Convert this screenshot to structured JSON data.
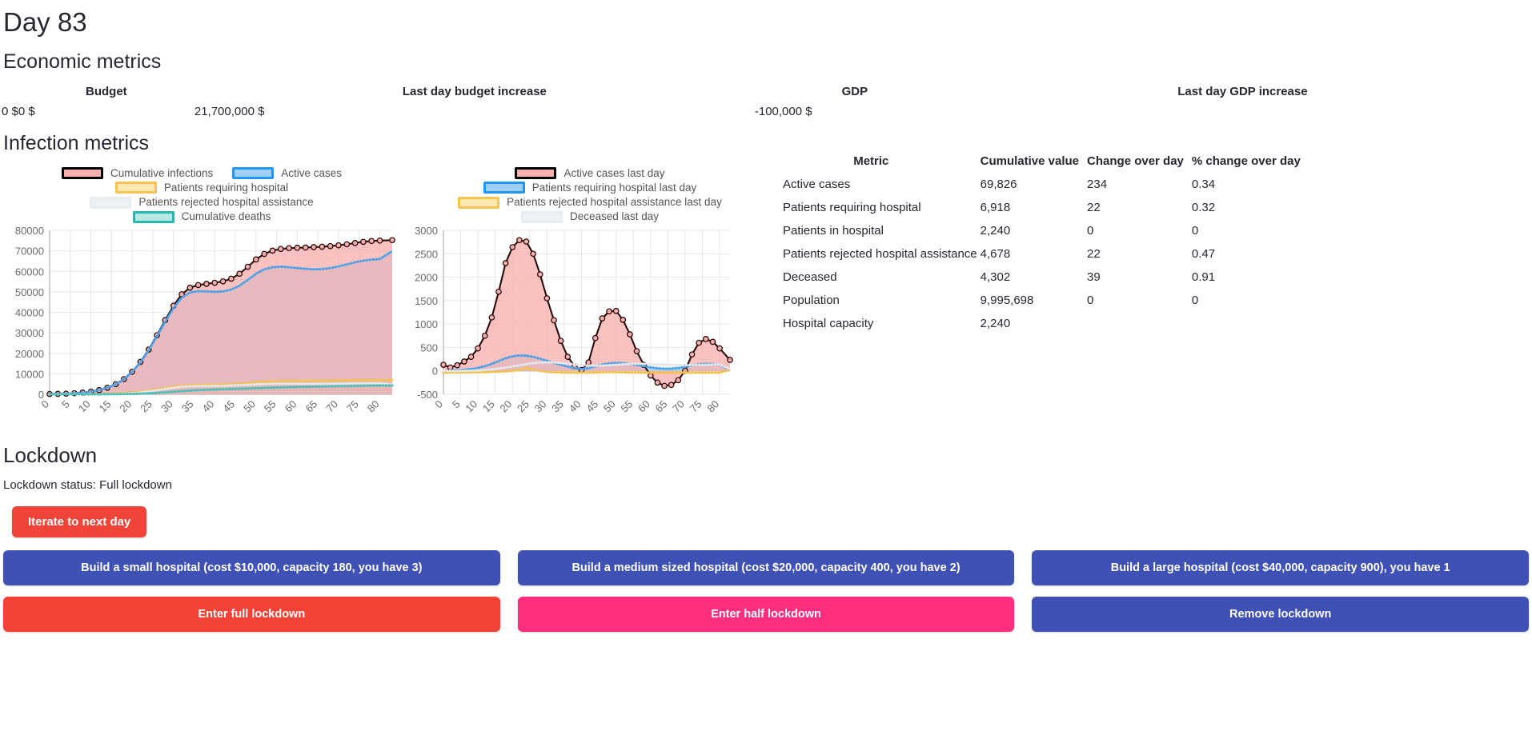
{
  "header": {
    "day_title": "Day 83"
  },
  "economic": {
    "section_title": "Economic metrics",
    "headers": [
      "Budget",
      "Last day budget increase",
      "GDP",
      "Last day GDP increase"
    ],
    "values": [
      "0 $",
      "0 $",
      "21,700,000 $",
      "-100,000 $"
    ]
  },
  "infection": {
    "section_title": "Infection metrics",
    "left_legend": [
      "Cumulative infections",
      "Active cases",
      "Patients requiring hospital",
      "Patients rejected hospital assistance",
      "Cumulative deaths"
    ],
    "right_legend": [
      "Active cases last day",
      "Patients requiring hospital last day",
      "Patients rejected hospital assistance last day",
      "Deceased last day"
    ],
    "table_headers": [
      "Metric",
      "Cumulative value",
      "Change over day",
      "% change over day"
    ],
    "rows": [
      {
        "metric": "Active cases",
        "cumulative": "69,826",
        "change": "234",
        "pct": "0.34"
      },
      {
        "metric": "Patients requiring hospital",
        "cumulative": "6,918",
        "change": "22",
        "pct": "0.32"
      },
      {
        "metric": "Patients in hospital",
        "cumulative": "2,240",
        "change": "0",
        "pct": "0"
      },
      {
        "metric": "Patients rejected hospital assistance",
        "cumulative": "4,678",
        "change": "22",
        "pct": "0.47"
      },
      {
        "metric": "Deceased",
        "cumulative": "4,302",
        "change": "39",
        "pct": "0.91"
      },
      {
        "metric": "Population",
        "cumulative": "9,995,698",
        "change": "0",
        "pct": "0"
      },
      {
        "metric": "Hospital capacity",
        "cumulative": "2,240",
        "change": "",
        "pct": ""
      }
    ]
  },
  "lockdown": {
    "section_title": "Lockdown",
    "status_text": "Lockdown status: Full lockdown",
    "iterate_label": "Iterate to next day",
    "build_buttons": [
      "Build a small hospital (cost $10,000, capacity 180, you have 3)",
      "Build a medium sized hospital (cost $20,000, capacity 400, you have 2)",
      "Build a large hospital (cost $40,000, capacity 900), you have 1"
    ],
    "lockdown_buttons": [
      "Enter full lockdown",
      "Enter half lockdown",
      "Remove lockdown"
    ]
  },
  "colors": {
    "cumulative_infections": "#f7b0ae",
    "active_cases": "#7fc4f2",
    "patients_requiring_hospital": "#fbd87f",
    "patients_rejected": "#eceff1",
    "cumulative_deaths": "#9fe0dd",
    "btn_blue": "#3f51b5",
    "btn_red": "#f44336",
    "btn_pink": "#ff2e7e",
    "btn_iterate": "#f04438"
  },
  "chart_data": [
    {
      "type": "area",
      "title": "Cumulative infection metrics",
      "xlabel": "",
      "ylabel": "",
      "xlim": [
        0,
        83
      ],
      "ylim": [
        0,
        80000
      ],
      "yticks": [
        0,
        10000,
        20000,
        30000,
        40000,
        50000,
        60000,
        70000,
        80000
      ],
      "xticks": [
        0,
        5,
        10,
        15,
        20,
        25,
        30,
        35,
        40,
        45,
        50,
        55,
        60,
        65,
        70,
        75,
        80
      ],
      "grid": true,
      "legend": "top",
      "x": [
        0,
        2,
        4,
        6,
        8,
        10,
        12,
        14,
        16,
        18,
        20,
        22,
        24,
        26,
        28,
        30,
        32,
        34,
        36,
        38,
        40,
        42,
        44,
        46,
        48,
        50,
        52,
        54,
        56,
        58,
        60,
        62,
        64,
        66,
        68,
        70,
        72,
        74,
        76,
        78,
        80,
        83
      ],
      "series": [
        {
          "name": "Cumulative infections",
          "color": "#f7b0ae",
          "values": [
            130,
            200,
            320,
            520,
            820,
            1300,
            2050,
            3200,
            4900,
            7400,
            11000,
            15800,
            21800,
            28800,
            36200,
            43200,
            48800,
            52000,
            53300,
            53900,
            54400,
            55100,
            56400,
            58800,
            62200,
            65800,
            68500,
            70100,
            70900,
            71300,
            71500,
            71600,
            71800,
            72000,
            72300,
            72700,
            73200,
            73800,
            74400,
            74800,
            75000,
            75200
          ]
        },
        {
          "name": "Active cases",
          "color": "#7fc4f2",
          "values": [
            130,
            200,
            320,
            520,
            820,
            1300,
            2050,
            3190,
            4880,
            7350,
            10900,
            15600,
            21500,
            28300,
            35400,
            42000,
            47100,
            49700,
            50300,
            50200,
            50000,
            50200,
            51100,
            53000,
            55800,
            58800,
            61000,
            62000,
            62300,
            62000,
            61600,
            61200,
            61000,
            61100,
            61600,
            62400,
            63400,
            64400,
            65200,
            65700,
            66000,
            69826
          ]
        },
        {
          "name": "Patients requiring hospital",
          "color": "#fbd87f",
          "values": [
            10,
            16,
            26,
            44,
            70,
            110,
            175,
            275,
            420,
            640,
            950,
            1360,
            1880,
            2480,
            3120,
            3720,
            4200,
            4480,
            4600,
            4680,
            4740,
            4820,
            4960,
            5200,
            5520,
            5860,
            6120,
            6290,
            6390,
            6450,
            6490,
            6530,
            6570,
            6620,
            6680,
            6740,
            6800,
            6850,
            6880,
            6900,
            6910,
            6918
          ]
        },
        {
          "name": "Patients rejected hospital assistance",
          "color": "#eceff1",
          "values": [
            0,
            0,
            0,
            0,
            0,
            0,
            0,
            20,
            90,
            240,
            520,
            930,
            1430,
            1990,
            2590,
            3160,
            3620,
            3880,
            3980,
            4050,
            4100,
            4170,
            4300,
            4480,
            4700,
            4900,
            5040,
            5120,
            5150,
            5160,
            5150,
            5140,
            5130,
            5140,
            5180,
            5240,
            5300,
            5360,
            5400,
            5420,
            5430,
            4678
          ]
        },
        {
          "name": "Cumulative deaths",
          "color": "#9fe0dd",
          "values": [
            0,
            0,
            0,
            0,
            2,
            6,
            14,
            30,
            60,
            110,
            190,
            310,
            480,
            700,
            960,
            1250,
            1540,
            1800,
            2020,
            2200,
            2350,
            2480,
            2600,
            2720,
            2850,
            2990,
            3130,
            3260,
            3380,
            3490,
            3580,
            3660,
            3730,
            3800,
            3870,
            3940,
            4010,
            4090,
            4170,
            4240,
            4290,
            4302
          ]
        }
      ]
    },
    {
      "type": "area",
      "title": "Daily infection metrics",
      "xlabel": "",
      "ylabel": "",
      "xlim": [
        0,
        83
      ],
      "ylim": [
        -500,
        3000
      ],
      "yticks": [
        -500,
        0,
        500,
        1000,
        1500,
        2000,
        2500,
        3000
      ],
      "xticks": [
        0,
        5,
        10,
        15,
        20,
        25,
        30,
        35,
        40,
        45,
        50,
        55,
        60,
        65,
        70,
        75,
        80
      ],
      "grid": true,
      "legend": "top",
      "x": [
        0,
        2,
        4,
        6,
        8,
        10,
        12,
        14,
        16,
        18,
        20,
        22,
        24,
        26,
        28,
        30,
        32,
        34,
        36,
        38,
        40,
        42,
        44,
        46,
        48,
        50,
        52,
        54,
        56,
        58,
        60,
        62,
        64,
        66,
        68,
        70,
        72,
        74,
        76,
        78,
        80,
        83
      ],
      "series": [
        {
          "name": "Active cases last day",
          "color": "#f7b0ae",
          "values": [
            130,
            70,
            120,
            200,
            300,
            480,
            750,
            1140,
            1690,
            2300,
            2640,
            2790,
            2760,
            2500,
            2060,
            1550,
            1080,
            640,
            300,
            100,
            20,
            180,
            700,
            1120,
            1270,
            1280,
            1090,
            780,
            420,
            130,
            -100,
            -250,
            -320,
            -300,
            -200,
            0,
            350,
            600,
            680,
            620,
            480,
            234
          ]
        },
        {
          "name": "Patients requiring hospital last day",
          "color": "#7fc4f2",
          "values": [
            -20,
            10,
            15,
            25,
            40,
            65,
            100,
            150,
            210,
            270,
            310,
            330,
            325,
            300,
            260,
            215,
            170,
            130,
            90,
            60,
            40,
            55,
            95,
            135,
            160,
            170,
            165,
            150,
            125,
            100,
            75,
            55,
            45,
            48,
            60,
            85,
            115,
            140,
            150,
            145,
            130,
            22
          ]
        },
        {
          "name": "Patients rejected hospital assistance last day",
          "color": "#fbd87f",
          "values": [
            -40,
            -38,
            -36,
            -34,
            -32,
            -30,
            -28,
            -24,
            -18,
            -10,
            0,
            20,
            60,
            30,
            0,
            -20,
            -30,
            -35,
            -38,
            -40,
            -40,
            -38,
            -35,
            -30,
            -28,
            -30,
            -33,
            -35,
            -37,
            -38,
            -38,
            -38,
            -38,
            -38,
            -38,
            -38,
            -38,
            -38,
            -38,
            -38,
            -38,
            22
          ]
        },
        {
          "name": "Deceased last day",
          "color": "#eceff1",
          "values": [
            0,
            0,
            0,
            2,
            5,
            10,
            18,
            30,
            48,
            70,
            95,
            120,
            145,
            165,
            178,
            183,
            180,
            170,
            155,
            140,
            125,
            115,
            110,
            112,
            120,
            130,
            140,
            148,
            152,
            152,
            148,
            142,
            136,
            130,
            126,
            124,
            124,
            126,
            130,
            134,
            138,
            39
          ]
        }
      ]
    }
  ]
}
